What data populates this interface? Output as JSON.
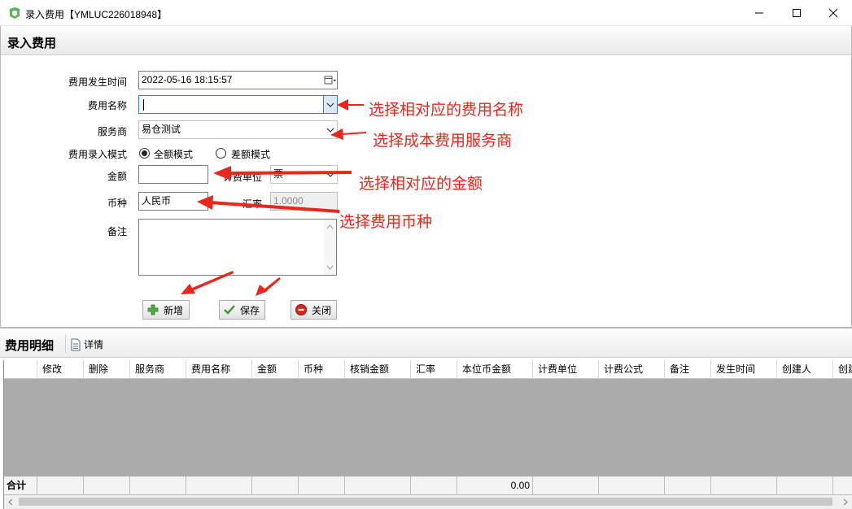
{
  "window": {
    "title": "录入费用【YMLUC226018948】"
  },
  "form_panel": {
    "title": "录入费用",
    "fields": {
      "occur_time": {
        "label": "费用发生时间",
        "value": "2022-05-16 18:15:57"
      },
      "fee_name": {
        "label": "费用名称",
        "value": ""
      },
      "provider": {
        "label": "服务商",
        "value": "易仓测试"
      },
      "mode": {
        "label": "费用录入模式",
        "options": [
          "全额模式",
          "差额模式"
        ],
        "selected": "全额模式"
      },
      "amount": {
        "label": "金额",
        "value": ""
      },
      "unit": {
        "label": "计费单位",
        "value": "票"
      },
      "currency": {
        "label": "币种",
        "value": "人民币"
      },
      "rate": {
        "label": "汇率",
        "value": "1.0000"
      },
      "remark": {
        "label": "备注",
        "value": ""
      }
    },
    "buttons": {
      "add": "新增",
      "save": "保存",
      "close": "关闭"
    }
  },
  "annotations": [
    "选择相对应的费用名称",
    "选择成本费用服务商",
    "选择相对应的金额",
    "选择费用币种"
  ],
  "detail_panel": {
    "title": "费用明细",
    "detail_button": "详情",
    "columns": [
      "",
      "修改",
      "删除",
      "服务商",
      "费用名称",
      "金额",
      "币种",
      "核销金额",
      "汇率",
      "本位币金额",
      "计费单位",
      "计费公式",
      "备注",
      "发生时间",
      "创建人",
      "创建"
    ],
    "footer_label": "合计",
    "footer_total": "0.00"
  },
  "colors": {
    "annotation": "#e8271d",
    "accent_border": "#3b78c8",
    "grid_empty": "#ababab"
  }
}
